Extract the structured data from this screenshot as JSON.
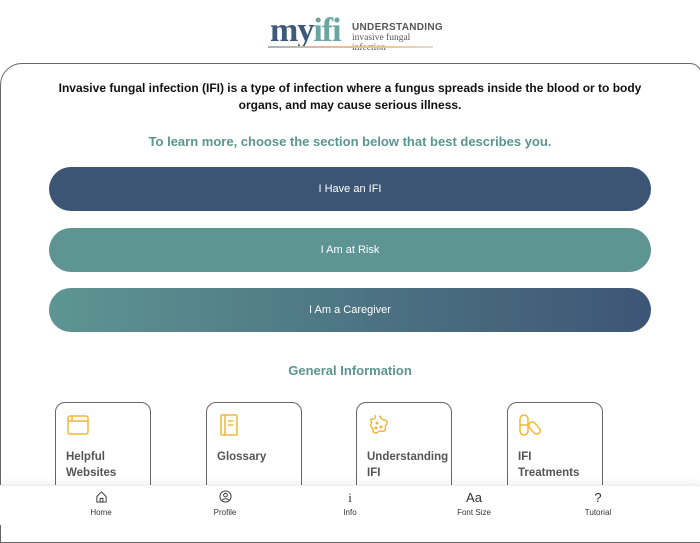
{
  "logo": {
    "brand_prefix": "my",
    "brand_suffix": "ifi",
    "line1": "UNDERSTANDING",
    "line2": "invasive fungal infection"
  },
  "intro": "Invasive fungal infection (IFI) is a type of infection where a fungus spreads inside the blood or to body organs, and may cause serious illness.",
  "subheading": "To learn more, choose the section below that best describes you.",
  "sections": [
    {
      "label": "I Have an IFI"
    },
    {
      "label": "I Am at Risk"
    },
    {
      "label": "I Am a Caregiver"
    }
  ],
  "general": {
    "title": "General Information",
    "cards": [
      {
        "label": "Helpful Websites",
        "icon": "browser-window-icon"
      },
      {
        "label": "Glossary",
        "icon": "book-icon"
      },
      {
        "label": "Understanding IFI",
        "icon": "fungus-icon"
      },
      {
        "label": "IFI Treatments",
        "icon": "pills-icon"
      }
    ]
  },
  "nav": [
    {
      "label": "Home",
      "icon": "home-icon"
    },
    {
      "label": "Profile",
      "icon": "profile-icon"
    },
    {
      "label": "Info",
      "icon": "info-icon"
    },
    {
      "label": "Font Size",
      "icon": "font-size-icon",
      "glyph": "Aa"
    },
    {
      "label": "Tutorial",
      "icon": "question-icon",
      "glyph": "?"
    }
  ],
  "colors": {
    "dark": "#3d5878",
    "teal": "#5e9592",
    "accent": "#f2b63a"
  }
}
